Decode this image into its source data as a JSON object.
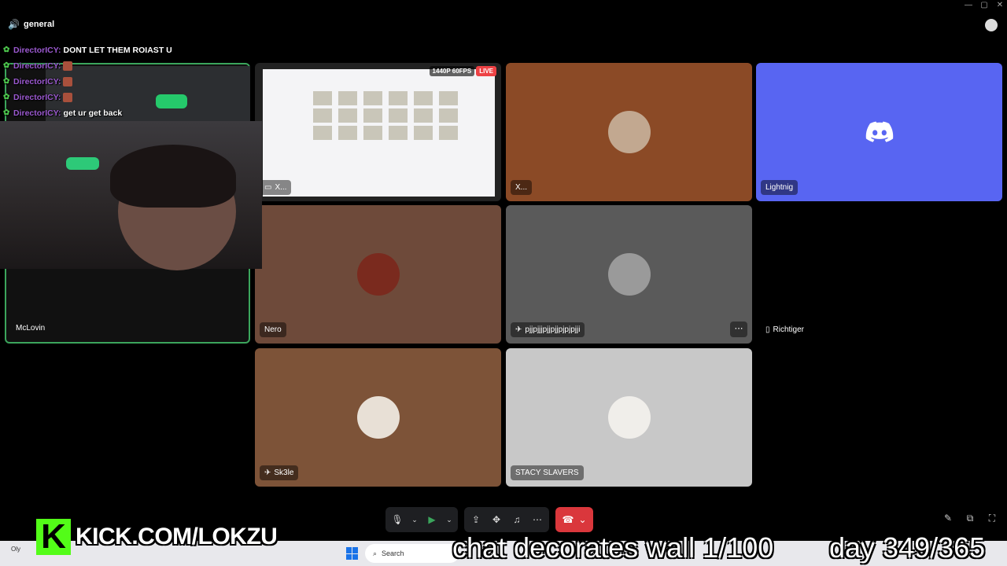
{
  "window": {
    "controls": [
      "—",
      "▢",
      "✕"
    ],
    "channel": "general"
  },
  "tiles": {
    "mclovin": "McLovin",
    "screen": "X...",
    "x": "X...",
    "lightnig": "Lightnig",
    "nero": "Nero",
    "pj": "pjjpjjjpjjpjjpjpjpjji",
    "richtiger": "Richtiger",
    "sk3le": "Sk3le",
    "stacy": "STACY SLAVERS",
    "stream_quality": "1440P 60FPS",
    "live": "LIVE"
  },
  "chat": [
    {
      "user": "DirectorICY:",
      "message": "DONT LET THEM ROIAST U"
    },
    {
      "user": "DirectorICY:",
      "message": ""
    },
    {
      "user": "DirectorICY:",
      "message": ""
    },
    {
      "user": "DirectorICY:",
      "message": ""
    },
    {
      "user": "DirectorICY:",
      "message": "get ur get back"
    }
  ],
  "overlay": {
    "kick_letter": "K",
    "kick_url": "KICK.COM/LOKZU",
    "goal_text": "chat decorates wall 1/100",
    "day_text": "day 349/365"
  },
  "taskbar": {
    "search": "Search",
    "weather": "Oly"
  },
  "icons": {
    "speaker": "speaker-icon",
    "mic": "microphone-icon",
    "camera": "camera-icon",
    "screen_share": "screen-share-icon",
    "activities": "activities-icon",
    "soundboard": "soundboard-icon",
    "more": "more-icon",
    "hangup": "hangup-icon"
  },
  "colors": {
    "speaking_border": "#3ba55c",
    "discord_blurple": "#5865f2",
    "hangup": "#da373c",
    "kick_green": "#53fc18",
    "chat_user": "#9b59d0"
  }
}
